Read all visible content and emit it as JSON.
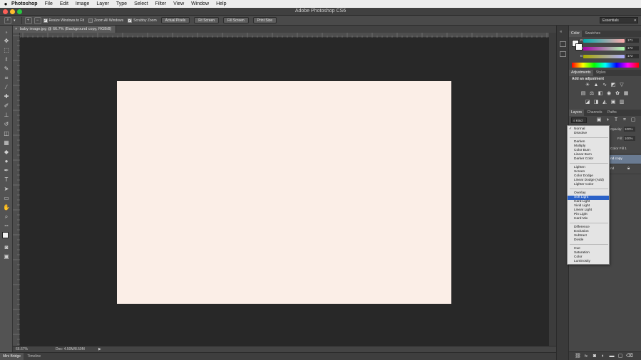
{
  "menubar": {
    "app_name": "Photoshop",
    "items": [
      "File",
      "Edit",
      "Image",
      "Layer",
      "Type",
      "Select",
      "Filter",
      "View",
      "Window",
      "Help"
    ]
  },
  "window": {
    "title": "Adobe Photoshop CS6"
  },
  "options_bar": {
    "resize_windows": "Resize Windows to Fit",
    "zoom_all": "Zoom All Windows",
    "scrubby_zoom": "Scrubby Zoom",
    "actual_pixels": "Actual Pixels",
    "fit_screen": "Fit Screen",
    "fill_screen": "Fill Screen",
    "print_size": "Print Size",
    "workspace": "Essentials"
  },
  "document": {
    "tab_title": "baby image.jpg @ 66.7% (Background copy, RGB/8)",
    "canvas_color": "#fbeee7",
    "zoom": "66.67%",
    "doc_size": "Doc: 4.50M/8.59M"
  },
  "bottom_tabs": [
    "Mini Bridge",
    "Timeline"
  ],
  "panels": {
    "color_tabs": [
      "Color",
      "Swatches"
    ],
    "color_values": [
      "171",
      "172",
      "172"
    ],
    "adjust_tabs": [
      "Adjustments",
      "Styles"
    ],
    "adjust_title": "Add an adjustment",
    "layer_tabs": [
      "Layers",
      "Channels",
      "Paths"
    ],
    "kind_label": "Kind",
    "opacity_label": "Opacity:",
    "opacity_value": "100%",
    "fill_label": "Fill:",
    "fill_value": "100%",
    "layer_names": [
      "Color Fill 1",
      "nd copy",
      "nd"
    ]
  },
  "blend_menu": {
    "selected": "Soft Light",
    "groups": [
      [
        "Normal",
        "Dissolve"
      ],
      [
        "Darken",
        "Multiply",
        "Color Burn",
        "Linear Burn",
        "Darker Color"
      ],
      [
        "Lighten",
        "Screen",
        "Color Dodge",
        "Linear Dodge (Add)",
        "Lighter Color"
      ],
      [
        "Overlay",
        "Soft Light",
        "Hard Light",
        "Vivid Light",
        "Linear Light",
        "Pin Light",
        "Hard Mix"
      ],
      [
        "Difference",
        "Exclusion",
        "Subtract",
        "Divide"
      ],
      [
        "Hue",
        "Saturation",
        "Color",
        "Luminosity"
      ]
    ]
  },
  "colors": {
    "accent": "#2b62c8",
    "canvas": "#fbeee7"
  }
}
